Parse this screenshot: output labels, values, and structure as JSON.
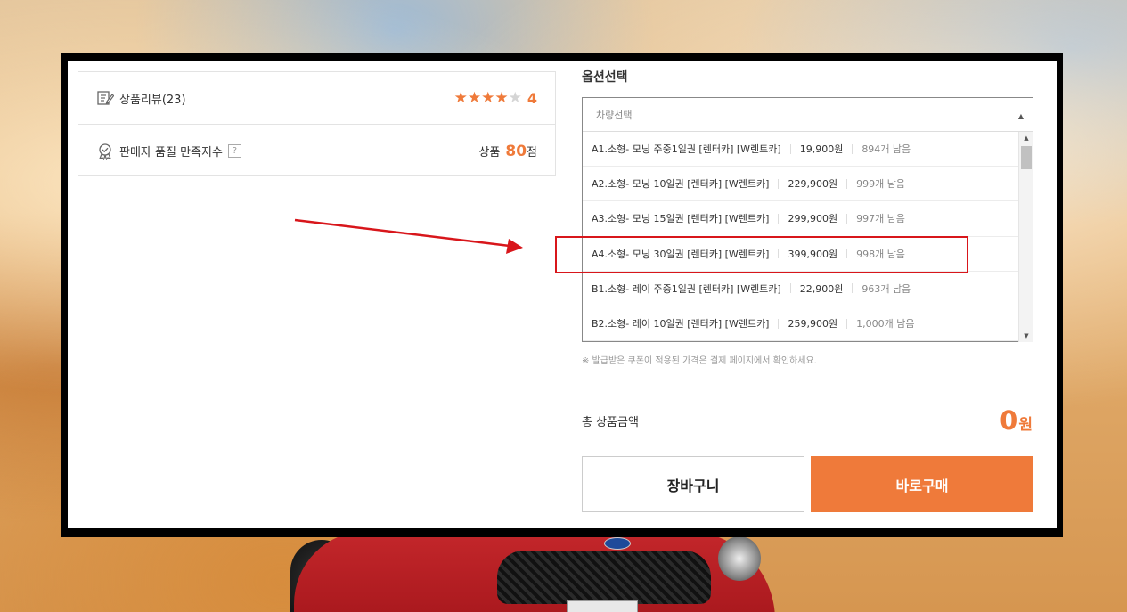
{
  "product_info": {
    "review_label": "상품리뷰(23)",
    "review_stars": 4,
    "review_score": "4",
    "quality_label": "판매자 품질 만족지수",
    "quality_help": "?",
    "quality_prefix": "상품",
    "quality_score": "80",
    "quality_unit": "점"
  },
  "options": {
    "title": "옵션선택",
    "placeholder": "차량선택",
    "items": [
      {
        "name": "A1.소형- 모닝 주중1일권 [렌터카] [W렌트카]",
        "price": "19,900원",
        "stock": "894개 남음"
      },
      {
        "name": "A2.소형- 모닝 10일권 [렌터카] [W렌트카]",
        "price": "229,900원",
        "stock": "999개 남음"
      },
      {
        "name": "A3.소형- 모닝 15일권 [렌터카] [W렌트카]",
        "price": "299,900원",
        "stock": "997개 남음"
      },
      {
        "name": "A4.소형- 모닝 30일권 [렌터카] [W렌트카]",
        "price": "399,900원",
        "stock": "998개 남음"
      },
      {
        "name": "B1.소형- 레이 주중1일권 [렌터카] [W렌트카]",
        "price": "22,900원",
        "stock": "963개 남음"
      },
      {
        "name": "B2.소형- 레이 10일권 [렌터카] [W렌트카]",
        "price": "259,900원",
        "stock": "1,000개 남음"
      }
    ],
    "notice": "※ 발급받은 쿠폰이 적용된 가격은 결제 페이지에서 확인하세요."
  },
  "total": {
    "label": "총 상품금액",
    "value": "0",
    "unit": "원"
  },
  "buttons": {
    "cart": "장바구니",
    "buy": "바로구매"
  },
  "colors": {
    "accent": "#ef7a3a",
    "annotation": "#d8161b"
  }
}
